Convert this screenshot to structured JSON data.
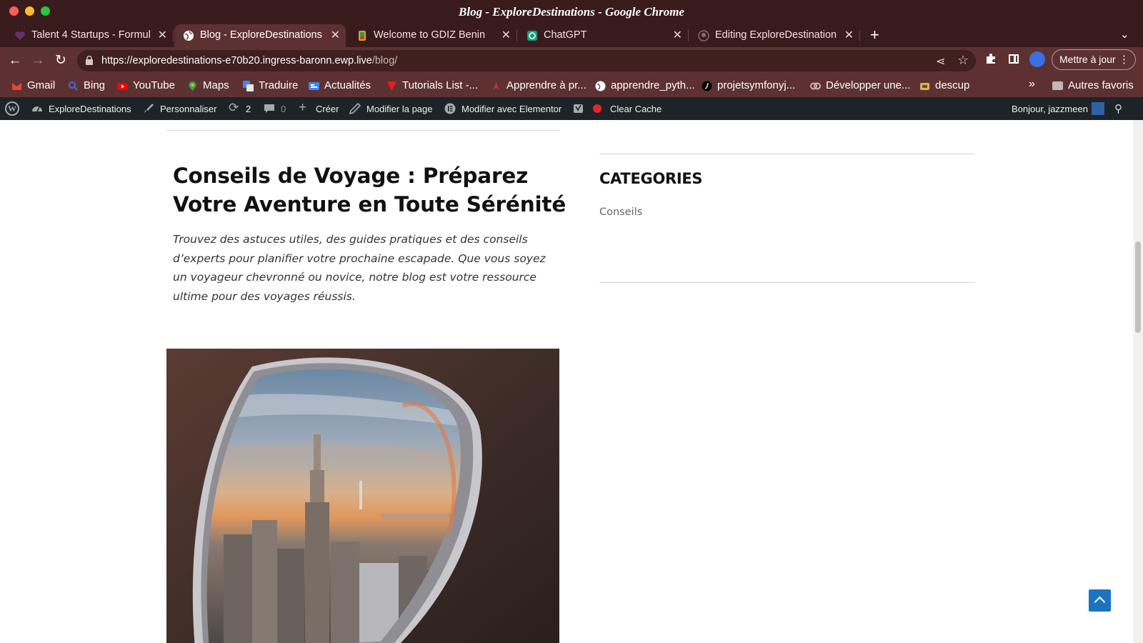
{
  "window": {
    "title": "Blog - ExploreDestinations - Google Chrome"
  },
  "tabs": [
    {
      "label": "Talent 4 Startups - Formul",
      "active": false,
      "icon": "heart-icon"
    },
    {
      "label": "Blog - ExploreDestinations",
      "active": true,
      "icon": "globe-icon"
    },
    {
      "label": "Welcome to GDIZ Benin",
      "active": false,
      "icon": "gdiz-icon"
    },
    {
      "label": "ChatGPT",
      "active": false,
      "icon": "chatgpt-icon"
    },
    {
      "label": "Editing ExploreDestination",
      "active": false,
      "icon": "github-icon"
    }
  ],
  "toolbar": {
    "url_host": "https://exploredestinations-e70b20.ingress-baronn.ewp.live",
    "url_path": "/blog/",
    "update_label": "Mettre à jour"
  },
  "bookmarks": [
    {
      "label": "Gmail",
      "icon": "gmail-icon",
      "color": "#ea4335"
    },
    {
      "label": "Bing",
      "icon": "bing-icon",
      "color": "#3b6fe0"
    },
    {
      "label": "YouTube",
      "icon": "youtube-icon",
      "color": "#ff0000"
    },
    {
      "label": "Maps",
      "icon": "maps-icon",
      "color": "#34a853"
    },
    {
      "label": "Traduire",
      "icon": "translate-icon",
      "color": "#4285f4"
    },
    {
      "label": "Actualités",
      "icon": "news-icon",
      "color": "#4285f4"
    },
    {
      "label": "Tutorials List -...",
      "icon": "tutorials-icon",
      "color": "#e51e1e"
    },
    {
      "label": "Apprendre à pr...",
      "icon": "apprendre-icon",
      "color": "#c03030"
    },
    {
      "label": "apprendre_pyth...",
      "icon": "globe-icon",
      "color": "#ffffff"
    },
    {
      "label": "projetsymfonyj...",
      "icon": "symfony-icon",
      "color": "#000000"
    },
    {
      "label": "Développer une...",
      "icon": "openclassrooms-icon",
      "color": "#7451eb"
    },
    {
      "label": "descup",
      "icon": "descup-icon",
      "color": "#d8b25a"
    }
  ],
  "bookmarks_other": "Autres favoris",
  "wpbar": {
    "site": "ExploreDestinations",
    "customize": "Personnaliser",
    "updates_count": "2",
    "comments_count": "0",
    "create": "Créer",
    "edit_page": "Modifier la page",
    "elementor": "Modifier avec Elementor",
    "clear_cache": "Clear Cache",
    "greeting": "Bonjour, jazzmeen"
  },
  "post": {
    "title": "Conseils de Voyage : Préparez Votre Aventure en Toute Sérénité",
    "excerpt": "Trouvez des astuces utiles, des guides pratiques et des conseils d’experts pour planifier votre prochaine escapade. Que vous soyez un voyageur chevronné ou novice, notre blog est votre ressource ultime pour des voyages réussis."
  },
  "sidebar": {
    "heading": "CATEGORIES",
    "categories": [
      "Conseils"
    ]
  },
  "colors": {
    "chrome_frame": "#3a1b1c",
    "chrome_toolbar": "#5d3132",
    "wp_admin_bar": "#1d2327",
    "scroll_top_button": "#1e73be"
  }
}
